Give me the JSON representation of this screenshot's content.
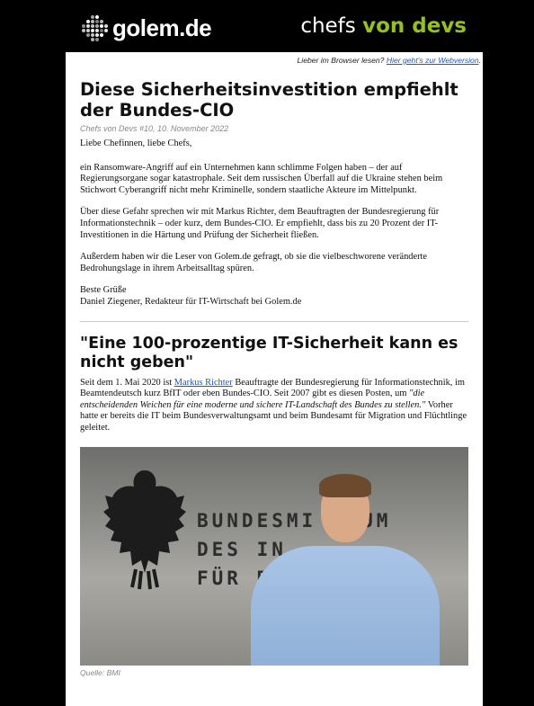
{
  "header": {
    "logo_text": "golem.de",
    "brand_prefix": "chefs",
    "brand_suffix": "von devs",
    "accent_color": "#95c11f"
  },
  "browser_line": {
    "text": "Lieber im Browser lesen?",
    "link": "Hier geht's zur Webversion"
  },
  "article": {
    "title": "Diese Sicherheitsinvestition empfiehlt der Bundes-CIO",
    "meta": "Chefs von Devs #10, 10. November 2022",
    "paragraphs": [
      "Liebe Chefinnen, liebe Chefs,",
      "ein Ransomware-Angriff auf ein Unternehmen kann schlimme Folgen haben – der auf Regierungsorgane sogar katastrophale. Seit dem russischen Überfall auf die Ukraine stehen beim Stichwort Cyberangriff nicht mehr Kriminelle, sondern staatliche Akteure im Mittelpunkt.",
      "Über diese Gefahr sprechen wir mit Markus Richter, dem Beauftragten der Bundesregierung für Informationstechnik – oder kurz, dem Bundes-CIO. Er empfiehlt, dass bis zu 20 Prozent der IT-Investitionen in die Härtung und Prüfung der Sicherheit fließen.",
      "Außerdem haben wir die Leser von Golem.de gefragt, ob sie die vielbeschworene veränderte Bedrohungslage in ihrem Arbeitsalltag spüren."
    ],
    "signoff": "Beste Grüße",
    "author": "Daniel Ziegener, Redakteur für IT-Wirtschaft bei Golem.de"
  },
  "section": {
    "title": "\"Eine 100-prozentige IT-Sicherheit kann es nicht geben\"",
    "p_pre": "Seit dem 1. Mai 2020 ist ",
    "p_link": "Markus Richter",
    "p_mid": " Beauftragte der Bundesregierung für Informationstechnik, im Beamtendeutsch kurz BfIT oder eben Bundes-CIO. Seit 2007 gibt es diesen Posten, um ",
    "p_quote": "\"die entscheidenden Weichen für eine moderne und sichere IT-Landschaft des Bundes zu stellen.\"",
    "p_post": " Vorher hatte er bereits die IT beim Bundesverwaltungsamt und beim Bundesamt für Migration und Flüchtlinge geleitet.",
    "image_wall_lines": [
      "BUNDESMI   RIUM",
      "DES IN    ",
      "FÜR B"
    ],
    "image_caption": "Quelle: BMI"
  }
}
